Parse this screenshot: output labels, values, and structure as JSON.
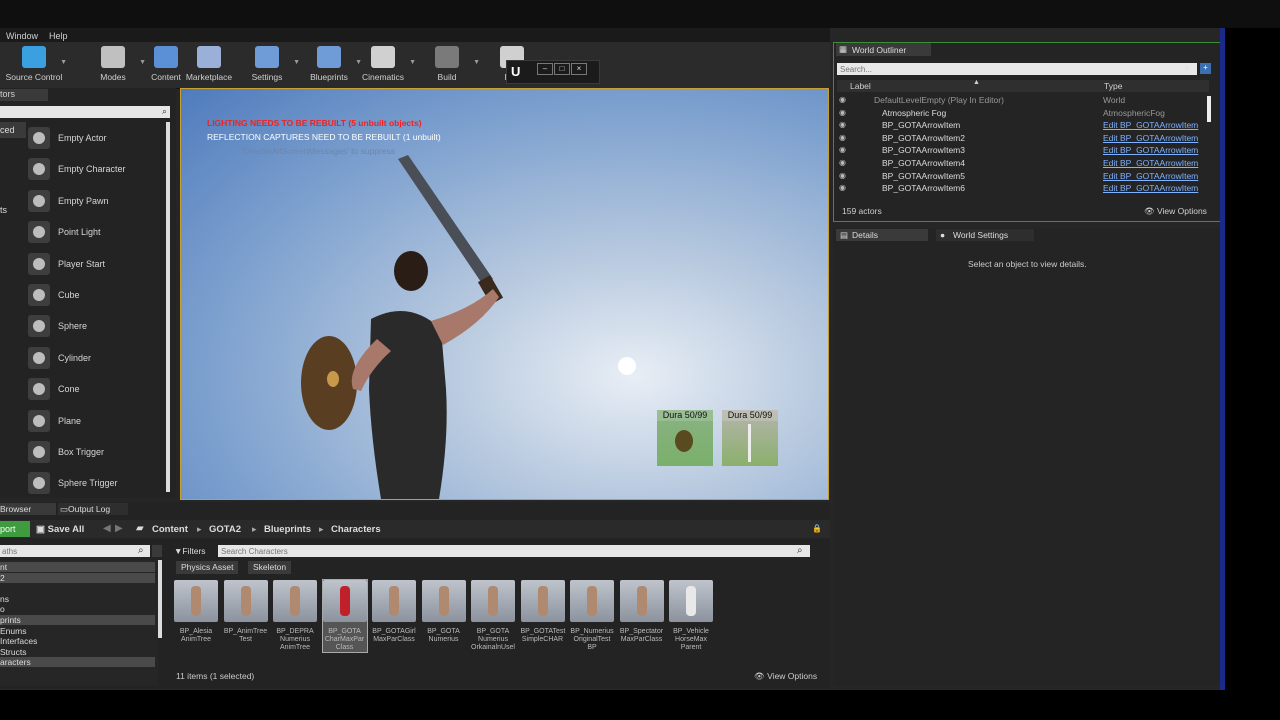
{
  "menu": {
    "window": "Window",
    "help": "Help"
  },
  "toolbar": [
    {
      "label": "Source Control",
      "icon": "source-control-icon",
      "color": "#3aa0e0"
    },
    {
      "label": "Modes",
      "icon": "modes-icon",
      "color": "#c0c0c0"
    },
    {
      "label": "Content",
      "icon": "content-icon",
      "color": "#5b8fd6"
    },
    {
      "label": "Marketplace",
      "icon": "marketplace-icon",
      "color": "#9bb0d8"
    },
    {
      "label": "Settings",
      "icon": "settings-icon",
      "color": "#6f9bd6"
    },
    {
      "label": "Blueprints",
      "icon": "blueprints-icon",
      "color": "#6f9bd6"
    },
    {
      "label": "Cinematics",
      "icon": "cinematics-icon",
      "color": "#d0d0d0"
    },
    {
      "label": "Build",
      "icon": "build-icon",
      "color": "#7a7a7a"
    },
    {
      "label": "Pau",
      "icon": "pause-icon",
      "color": "#d0d0d0"
    }
  ],
  "modes": {
    "tab_label": "tors",
    "tab_label_2": "ced",
    "side_label": "ts",
    "items": [
      {
        "label": "Empty Actor"
      },
      {
        "label": "Empty Character"
      },
      {
        "label": "Empty Pawn"
      },
      {
        "label": "Point Light"
      },
      {
        "label": "Player Start"
      },
      {
        "label": "Cube"
      },
      {
        "label": "Sphere"
      },
      {
        "label": "Cylinder"
      },
      {
        "label": "Cone"
      },
      {
        "label": "Plane"
      },
      {
        "label": "Box Trigger"
      },
      {
        "label": "Sphere Trigger"
      }
    ]
  },
  "viewport": {
    "warn_lighting": "LIGHTING NEEDS TO BE REBUILT (5 unbuilt objects)",
    "warn_reflection": "REFLECTION CAPTURES NEED TO BE REBUILT (1 unbuilt)",
    "warn_suppress": "'DisableAllScreenMessages' to suppress",
    "hud": [
      {
        "title": "Dura 50/99"
      },
      {
        "title": "Dura 50/99"
      }
    ]
  },
  "outliner": {
    "tab": "World Outliner",
    "search_placeholder": "Search...",
    "col_label": "Label",
    "col_type": "Type",
    "rows": [
      {
        "name": "DefaultLevelEmpty (Play In Editor)",
        "type": "World"
      },
      {
        "name": "Atmospheric Fog",
        "type": "AtmosphericFog"
      },
      {
        "name": "BP_GOTAArrowItem",
        "type": "Edit BP_GOTAArrowItem"
      },
      {
        "name": "BP_GOTAArrowItem2",
        "type": "Edit BP_GOTAArrowItem"
      },
      {
        "name": "BP_GOTAArrowItem3",
        "type": "Edit BP_GOTAArrowItem"
      },
      {
        "name": "BP_GOTAArrowItem4",
        "type": "Edit BP_GOTAArrowItem"
      },
      {
        "name": "BP_GOTAArrowItem5",
        "type": "Edit BP_GOTAArrowItem"
      },
      {
        "name": "BP_GOTAArrowItem6",
        "type": "Edit BP_GOTAArrowItem"
      }
    ],
    "actor_count": "159 actors",
    "view_options": "View Options"
  },
  "details": {
    "tab_details": "Details",
    "tab_world": "World Settings",
    "empty_msg": "Select an object to view details."
  },
  "content_browser": {
    "tab_browser": "Browser",
    "tab_output": "Output Log",
    "import": "port",
    "save_all": "Save All",
    "breadcrumb": [
      "Content",
      "GOTA2",
      "Blueprints",
      "Characters"
    ],
    "paths_placeholder": "aths",
    "filters": "Filters",
    "search_placeholder": "Search Characters",
    "filter_chips": [
      "Physics Asset",
      "Skeleton"
    ],
    "tree": [
      "nt",
      "2",
      "",
      "ns",
      "o",
      "prints",
      "Enums",
      "Interfaces",
      "Structs",
      "aracters"
    ],
    "assets": [
      "BP_Alesia AnimTree",
      "BP_AnimTree Test",
      "BP_DEPRA Numerius AnimTree",
      "BP_GOTA CharMaxPar Class",
      "BP_GOTAGirl MaxParClass",
      "BP_GOTA Numerius",
      "BP_GOTA Numerius OrkainalnUsel",
      "BP_GOTATest SimpleCHAR",
      "BP_Numerius OriginalTest BP",
      "BP_Spectator MaxParClass",
      "BP_Vehicle HorseMax Parent"
    ],
    "status": "11 items (1 selected)",
    "view_options": "View Options"
  }
}
